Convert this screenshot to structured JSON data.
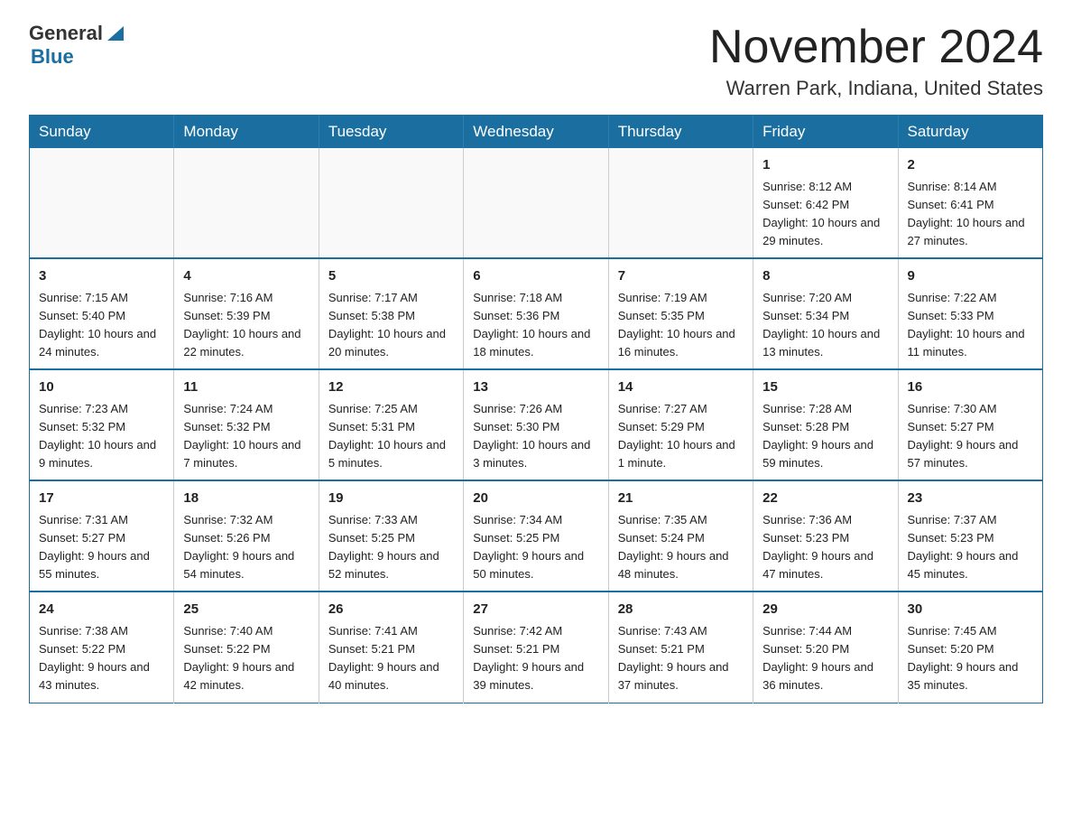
{
  "header": {
    "logo_general": "General",
    "logo_blue": "Blue",
    "month_title": "November 2024",
    "location": "Warren Park, Indiana, United States"
  },
  "weekdays": [
    "Sunday",
    "Monday",
    "Tuesday",
    "Wednesday",
    "Thursday",
    "Friday",
    "Saturday"
  ],
  "weeks": [
    [
      {
        "day": "",
        "info": ""
      },
      {
        "day": "",
        "info": ""
      },
      {
        "day": "",
        "info": ""
      },
      {
        "day": "",
        "info": ""
      },
      {
        "day": "",
        "info": ""
      },
      {
        "day": "1",
        "info": "Sunrise: 8:12 AM\nSunset: 6:42 PM\nDaylight: 10 hours and 29 minutes."
      },
      {
        "day": "2",
        "info": "Sunrise: 8:14 AM\nSunset: 6:41 PM\nDaylight: 10 hours and 27 minutes."
      }
    ],
    [
      {
        "day": "3",
        "info": "Sunrise: 7:15 AM\nSunset: 5:40 PM\nDaylight: 10 hours and 24 minutes."
      },
      {
        "day": "4",
        "info": "Sunrise: 7:16 AM\nSunset: 5:39 PM\nDaylight: 10 hours and 22 minutes."
      },
      {
        "day": "5",
        "info": "Sunrise: 7:17 AM\nSunset: 5:38 PM\nDaylight: 10 hours and 20 minutes."
      },
      {
        "day": "6",
        "info": "Sunrise: 7:18 AM\nSunset: 5:36 PM\nDaylight: 10 hours and 18 minutes."
      },
      {
        "day": "7",
        "info": "Sunrise: 7:19 AM\nSunset: 5:35 PM\nDaylight: 10 hours and 16 minutes."
      },
      {
        "day": "8",
        "info": "Sunrise: 7:20 AM\nSunset: 5:34 PM\nDaylight: 10 hours and 13 minutes."
      },
      {
        "day": "9",
        "info": "Sunrise: 7:22 AM\nSunset: 5:33 PM\nDaylight: 10 hours and 11 minutes."
      }
    ],
    [
      {
        "day": "10",
        "info": "Sunrise: 7:23 AM\nSunset: 5:32 PM\nDaylight: 10 hours and 9 minutes."
      },
      {
        "day": "11",
        "info": "Sunrise: 7:24 AM\nSunset: 5:32 PM\nDaylight: 10 hours and 7 minutes."
      },
      {
        "day": "12",
        "info": "Sunrise: 7:25 AM\nSunset: 5:31 PM\nDaylight: 10 hours and 5 minutes."
      },
      {
        "day": "13",
        "info": "Sunrise: 7:26 AM\nSunset: 5:30 PM\nDaylight: 10 hours and 3 minutes."
      },
      {
        "day": "14",
        "info": "Sunrise: 7:27 AM\nSunset: 5:29 PM\nDaylight: 10 hours and 1 minute."
      },
      {
        "day": "15",
        "info": "Sunrise: 7:28 AM\nSunset: 5:28 PM\nDaylight: 9 hours and 59 minutes."
      },
      {
        "day": "16",
        "info": "Sunrise: 7:30 AM\nSunset: 5:27 PM\nDaylight: 9 hours and 57 minutes."
      }
    ],
    [
      {
        "day": "17",
        "info": "Sunrise: 7:31 AM\nSunset: 5:27 PM\nDaylight: 9 hours and 55 minutes."
      },
      {
        "day": "18",
        "info": "Sunrise: 7:32 AM\nSunset: 5:26 PM\nDaylight: 9 hours and 54 minutes."
      },
      {
        "day": "19",
        "info": "Sunrise: 7:33 AM\nSunset: 5:25 PM\nDaylight: 9 hours and 52 minutes."
      },
      {
        "day": "20",
        "info": "Sunrise: 7:34 AM\nSunset: 5:25 PM\nDaylight: 9 hours and 50 minutes."
      },
      {
        "day": "21",
        "info": "Sunrise: 7:35 AM\nSunset: 5:24 PM\nDaylight: 9 hours and 48 minutes."
      },
      {
        "day": "22",
        "info": "Sunrise: 7:36 AM\nSunset: 5:23 PM\nDaylight: 9 hours and 47 minutes."
      },
      {
        "day": "23",
        "info": "Sunrise: 7:37 AM\nSunset: 5:23 PM\nDaylight: 9 hours and 45 minutes."
      }
    ],
    [
      {
        "day": "24",
        "info": "Sunrise: 7:38 AM\nSunset: 5:22 PM\nDaylight: 9 hours and 43 minutes."
      },
      {
        "day": "25",
        "info": "Sunrise: 7:40 AM\nSunset: 5:22 PM\nDaylight: 9 hours and 42 minutes."
      },
      {
        "day": "26",
        "info": "Sunrise: 7:41 AM\nSunset: 5:21 PM\nDaylight: 9 hours and 40 minutes."
      },
      {
        "day": "27",
        "info": "Sunrise: 7:42 AM\nSunset: 5:21 PM\nDaylight: 9 hours and 39 minutes."
      },
      {
        "day": "28",
        "info": "Sunrise: 7:43 AM\nSunset: 5:21 PM\nDaylight: 9 hours and 37 minutes."
      },
      {
        "day": "29",
        "info": "Sunrise: 7:44 AM\nSunset: 5:20 PM\nDaylight: 9 hours and 36 minutes."
      },
      {
        "day": "30",
        "info": "Sunrise: 7:45 AM\nSunset: 5:20 PM\nDaylight: 9 hours and 35 minutes."
      }
    ]
  ]
}
